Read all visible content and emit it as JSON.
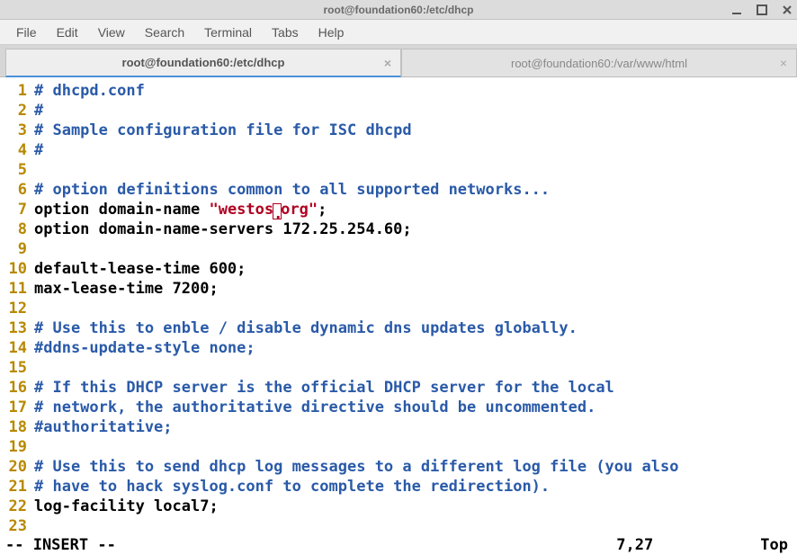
{
  "window": {
    "title": "root@foundation60:/etc/dhcp"
  },
  "menu": {
    "items": [
      "File",
      "Edit",
      "View",
      "Search",
      "Terminal",
      "Tabs",
      "Help"
    ]
  },
  "tabs": [
    {
      "label": "root@foundation60:/etc/dhcp",
      "active": true
    },
    {
      "label": "root@foundation60:/var/www/html",
      "active": false
    }
  ],
  "editor": {
    "lines": [
      {
        "n": 1,
        "segments": [
          {
            "cls": "c-comment",
            "t": "# dhcpd.conf"
          }
        ]
      },
      {
        "n": 2,
        "segments": [
          {
            "cls": "c-comment",
            "t": "#"
          }
        ]
      },
      {
        "n": 3,
        "segments": [
          {
            "cls": "c-comment",
            "t": "# Sample configuration file for ISC dhcpd"
          }
        ]
      },
      {
        "n": 4,
        "segments": [
          {
            "cls": "c-comment",
            "t": "#"
          }
        ]
      },
      {
        "n": 5,
        "segments": []
      },
      {
        "n": 6,
        "segments": [
          {
            "cls": "c-comment",
            "t": "# option definitions common to all supported networks..."
          }
        ]
      },
      {
        "n": 7,
        "segments": [
          {
            "cls": "c-text",
            "t": "option domain-name "
          },
          {
            "cls": "c-str",
            "t": "\"westos"
          },
          {
            "cls": "cursor",
            "t": "."
          },
          {
            "cls": "c-str",
            "t": "org\""
          },
          {
            "cls": "c-text",
            "t": ";"
          }
        ]
      },
      {
        "n": 8,
        "segments": [
          {
            "cls": "c-text",
            "t": "option domain-name-servers 172.25.254.60;"
          }
        ]
      },
      {
        "n": 9,
        "segments": []
      },
      {
        "n": 10,
        "segments": [
          {
            "cls": "c-text",
            "t": "default-lease-time 600;"
          }
        ]
      },
      {
        "n": 11,
        "segments": [
          {
            "cls": "c-text",
            "t": "max-lease-time 7200;"
          }
        ]
      },
      {
        "n": 12,
        "segments": []
      },
      {
        "n": 13,
        "segments": [
          {
            "cls": "c-comment",
            "t": "# Use this to enble / disable dynamic dns updates globally."
          }
        ]
      },
      {
        "n": 14,
        "segments": [
          {
            "cls": "c-comment",
            "t": "#ddns-update-style none;"
          }
        ]
      },
      {
        "n": 15,
        "segments": []
      },
      {
        "n": 16,
        "segments": [
          {
            "cls": "c-comment",
            "t": "# If this DHCP server is the official DHCP server for the local"
          }
        ]
      },
      {
        "n": 17,
        "segments": [
          {
            "cls": "c-comment",
            "t": "# network, the authoritative directive should be uncommented."
          }
        ]
      },
      {
        "n": 18,
        "segments": [
          {
            "cls": "c-comment",
            "t": "#authoritative;"
          }
        ]
      },
      {
        "n": 19,
        "segments": []
      },
      {
        "n": 20,
        "segments": [
          {
            "cls": "c-comment",
            "t": "# Use this to send dhcp log messages to a different log file (you also"
          }
        ]
      },
      {
        "n": 21,
        "segments": [
          {
            "cls": "c-comment",
            "t": "# have to hack syslog.conf to complete the redirection)."
          }
        ]
      },
      {
        "n": 22,
        "segments": [
          {
            "cls": "c-text",
            "t": "log-facility local7;"
          }
        ]
      },
      {
        "n": 23,
        "segments": []
      }
    ]
  },
  "status": {
    "mode": "-- INSERT --",
    "position": "7,27",
    "scroll": "Top"
  }
}
